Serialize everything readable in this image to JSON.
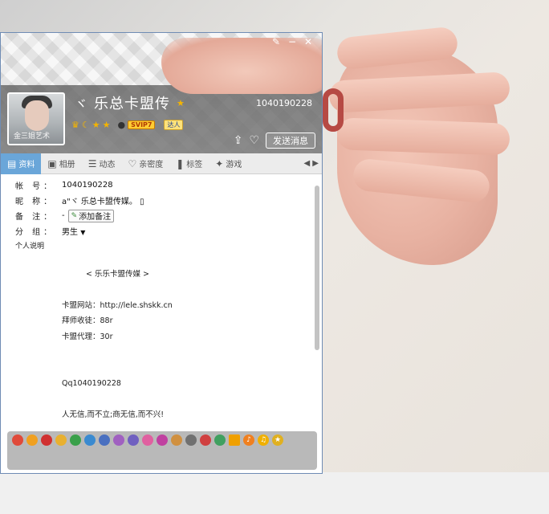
{
  "profile": {
    "nickname": "乐总卡盟传",
    "signature_mark": "ヾ",
    "qq_number": "1040190228",
    "avatar_caption": "金三姐艺术",
    "vip_label": "SVIP7",
    "daren_label": "达人",
    "send_message_label": "发送消息"
  },
  "tabs": [
    {
      "icon": "资",
      "label": "资料"
    },
    {
      "icon": "相",
      "label": "相册"
    },
    {
      "icon": "动",
      "label": "动态"
    },
    {
      "icon": "亲",
      "label": "亲密度"
    },
    {
      "icon": "标",
      "label": "标签"
    },
    {
      "icon": "游",
      "label": "游戏"
    }
  ],
  "fields": {
    "account_label": "帐 号：",
    "account_value": "1040190228",
    "nick_label": "昵 称：",
    "nick_value": "a\"ヾ  乐总卡盟传媒。 ▯",
    "remark_label": "备 注：",
    "remark_dash": "-",
    "add_remark_label": "添加备注",
    "group_label": "分 组：",
    "group_value": "男生",
    "desc_label": "个人说明"
  },
  "description": {
    "line_title": "< 乐乐卡盟传媒 >",
    "line_site": "卡盟网站：http://lele.shskk.cn",
    "line_apprentice": "拜师收徒：88r",
    "line_agent": "卡盟代理：30r",
    "line_qq": "Qq1040190228",
    "line_motto": "人无信,而不立;商无信,而不兴!"
  },
  "colors": {
    "window_border": "#6f8cb4",
    "tab_active": "#6aa6d9",
    "badge_bar": "#b9b9b9"
  }
}
